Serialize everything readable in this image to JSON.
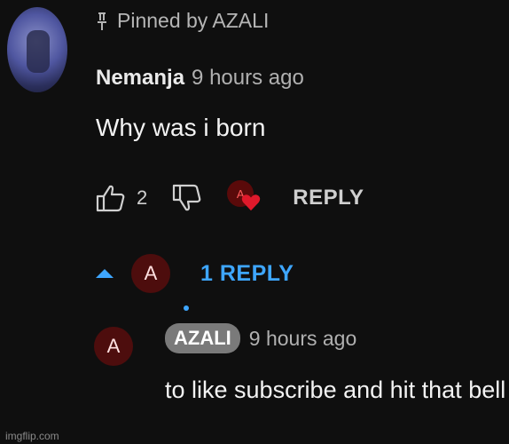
{
  "pinned": {
    "label": "Pinned by AZALI"
  },
  "comment": {
    "author": "Nemanja",
    "time": "9 hours ago",
    "text": "Why was i born",
    "likes": "2",
    "heart_avatar_letter": "A",
    "reply_label": "REPLY"
  },
  "replies_toggle": {
    "avatar_letter": "A",
    "label": "1 REPLY"
  },
  "reply": {
    "avatar_letter": "A",
    "author_badge": "AZALI",
    "time": "9 hours ago",
    "text": "to like subscribe and hit that bell"
  },
  "watermark": "imgflip.com",
  "colors": {
    "background": "#0f0f0f",
    "link_blue": "#3ea6ff",
    "heart_red": "#e0192b",
    "avatar_red": "#4d0d0d"
  },
  "icons": [
    "pin-icon",
    "thumbs-up-icon",
    "thumbs-down-icon",
    "heart-icon",
    "caret-up-icon"
  ]
}
